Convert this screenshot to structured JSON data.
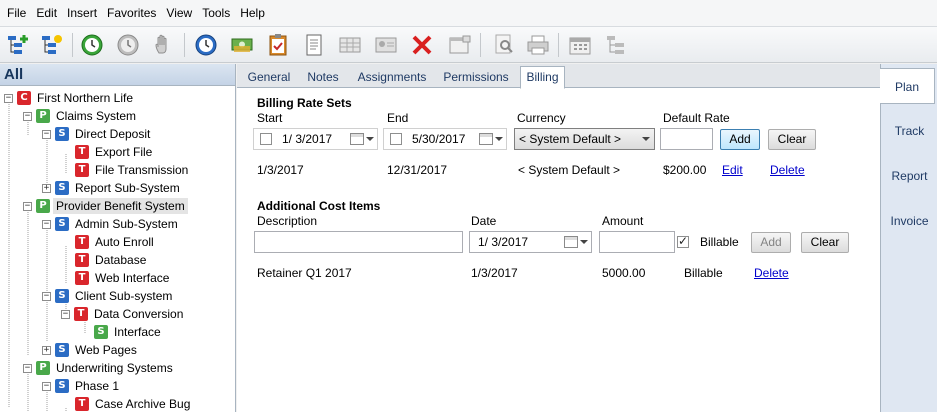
{
  "menu": [
    "File",
    "Edit",
    "Insert",
    "Favorites",
    "View",
    "Tools",
    "Help"
  ],
  "toolbar_icons": [
    "add-child-node-icon",
    "add-sibling-node-icon",
    "clock-start-icon",
    "clock-gray-icon",
    "hand-icon",
    "clock-blue-icon",
    "money-icon",
    "clipboard-check-icon",
    "document-icon",
    "table-icon",
    "contact-card-icon",
    "delete-x-icon",
    "window-icon",
    "preview-icon",
    "printer-icon",
    "calendar-icon",
    "hierarchy-icon"
  ],
  "tree": {
    "header": "All",
    "nodes": [
      {
        "badge": "C",
        "label": "First Northern Life"
      },
      {
        "badge": "P",
        "label": "Claims System"
      },
      {
        "badge": "S",
        "label": "Direct Deposit"
      },
      {
        "badge": "T",
        "label": "Export File"
      },
      {
        "badge": "T",
        "label": "File Transmission"
      },
      {
        "badge": "S",
        "label": "Report Sub-System"
      },
      {
        "badge": "P",
        "label": "Provider Benefit System"
      },
      {
        "badge": "S",
        "label": "Admin Sub-System"
      },
      {
        "badge": "T",
        "label": "Auto Enroll"
      },
      {
        "badge": "T",
        "label": "Database"
      },
      {
        "badge": "T",
        "label": "Web Interface"
      },
      {
        "badge": "S",
        "label": "Client Sub-system"
      },
      {
        "badge": "T",
        "label": "Data Conversion"
      },
      {
        "badge": "S",
        "label": "Interface"
      },
      {
        "badge": "S",
        "label": "Web Pages"
      },
      {
        "badge": "P",
        "label": "Underwriting Systems"
      },
      {
        "badge": "S",
        "label": "Phase 1"
      },
      {
        "badge": "T",
        "label": "Case Archive Bug"
      }
    ]
  },
  "tabs": [
    "General",
    "Notes",
    "Assignments",
    "Permissions",
    "Billing"
  ],
  "side_tabs": [
    "Plan",
    "Track",
    "Report",
    "Invoice"
  ],
  "billing": {
    "rate_sets_title": "Billing Rate Sets",
    "start_label": "Start",
    "end_label": "End",
    "currency_label": "Currency",
    "default_rate_label": "Default Rate",
    "start_value": "1/  3/2017",
    "end_value": "5/30/2017",
    "currency_value": "< System Default >",
    "default_rate_value": "",
    "add_label": "Add",
    "clear_label": "Clear",
    "rate_row": {
      "start": "1/3/2017",
      "end": "12/31/2017",
      "currency": "< System Default >",
      "rate": "$200.00",
      "edit": "Edit",
      "delete": "Delete"
    }
  },
  "costs": {
    "title": "Additional Cost Items",
    "description_label": "Description",
    "date_label": "Date",
    "amount_label": "Amount",
    "description_value": "",
    "date_value": "1/  3/2017",
    "amount_value": "",
    "billable_label": "Billable",
    "add_label": "Add",
    "clear_label": "Clear",
    "row": {
      "description": "Retainer Q1 2017",
      "date": "1/3/2017",
      "amount": "5000.00",
      "billable": "Billable",
      "delete": "Delete"
    }
  }
}
